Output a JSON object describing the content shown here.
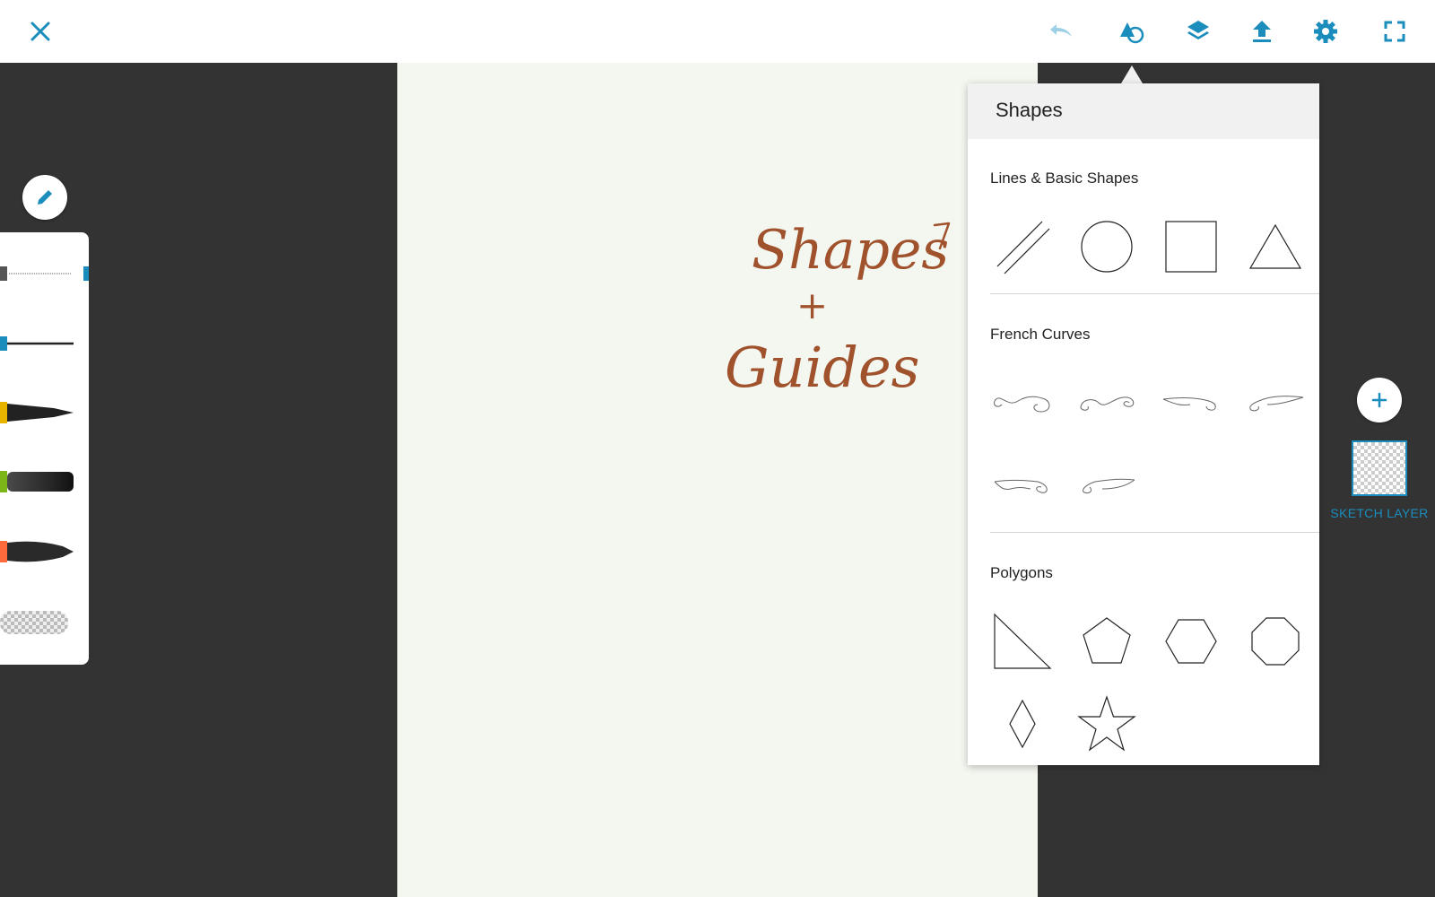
{
  "colors": {
    "accent": "#1a8dbd",
    "workspace": "#333333",
    "canvas": "#f4f6f0",
    "ink": "#a0522d"
  },
  "toolbar": {
    "close_icon": "close-icon",
    "undo_icon": "undo-icon",
    "shapes_icon": "shapes-icon",
    "layers_icon": "layers-icon",
    "export_icon": "export-icon",
    "settings_icon": "gear-icon",
    "fullscreen_icon": "fullscreen-icon"
  },
  "brushes": [
    {
      "name": "fine-pen",
      "color": "#555555"
    },
    {
      "name": "thin-line",
      "color": "#1a8dbd"
    },
    {
      "name": "tapered-marker",
      "color": "#e8b400"
    },
    {
      "name": "soft-brush",
      "color": "#7cb518"
    },
    {
      "name": "ink-brush",
      "color": "#ff6a3d"
    },
    {
      "name": "eraser",
      "color": "#cccccc"
    }
  ],
  "shapes_panel": {
    "title": "Shapes",
    "sections": [
      {
        "label": "Lines & Basic Shapes",
        "items": [
          "parallel-lines",
          "circle",
          "square",
          "triangle"
        ]
      },
      {
        "label": "French Curves",
        "items": [
          "french-curve-1",
          "french-curve-2",
          "french-curve-3",
          "french-curve-4",
          "french-curve-5",
          "french-curve-6"
        ]
      },
      {
        "label": "Polygons",
        "items": [
          "right-triangle",
          "pentagon",
          "hexagon",
          "octagon",
          "diamond",
          "star"
        ]
      }
    ]
  },
  "canvas": {
    "handwriting": [
      "Shapes",
      "+",
      "Guides"
    ]
  },
  "layers": {
    "add_icon": "plus-icon",
    "active_layer_label": "SKETCH LAYER"
  }
}
